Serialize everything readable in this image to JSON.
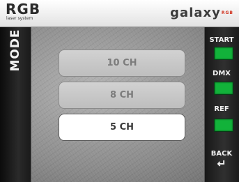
{
  "header": {
    "brand_left": "RGB",
    "brand_left_sub": "laser system",
    "brand_right": "galaxy",
    "brand_right_suffix": "RGB"
  },
  "side": {
    "title": "MODE"
  },
  "channels": {
    "options": [
      {
        "label": "10 CH",
        "selected": false
      },
      {
        "label": "8 CH",
        "selected": false
      },
      {
        "label": "5 CH",
        "selected": true
      }
    ]
  },
  "right_panel": {
    "start_label": "START",
    "dmx_label": "DMX",
    "ref_label": "REF",
    "back_label": "BACK",
    "back_icon": "return-arrow-icon",
    "indicator_color": "#12b23a"
  }
}
